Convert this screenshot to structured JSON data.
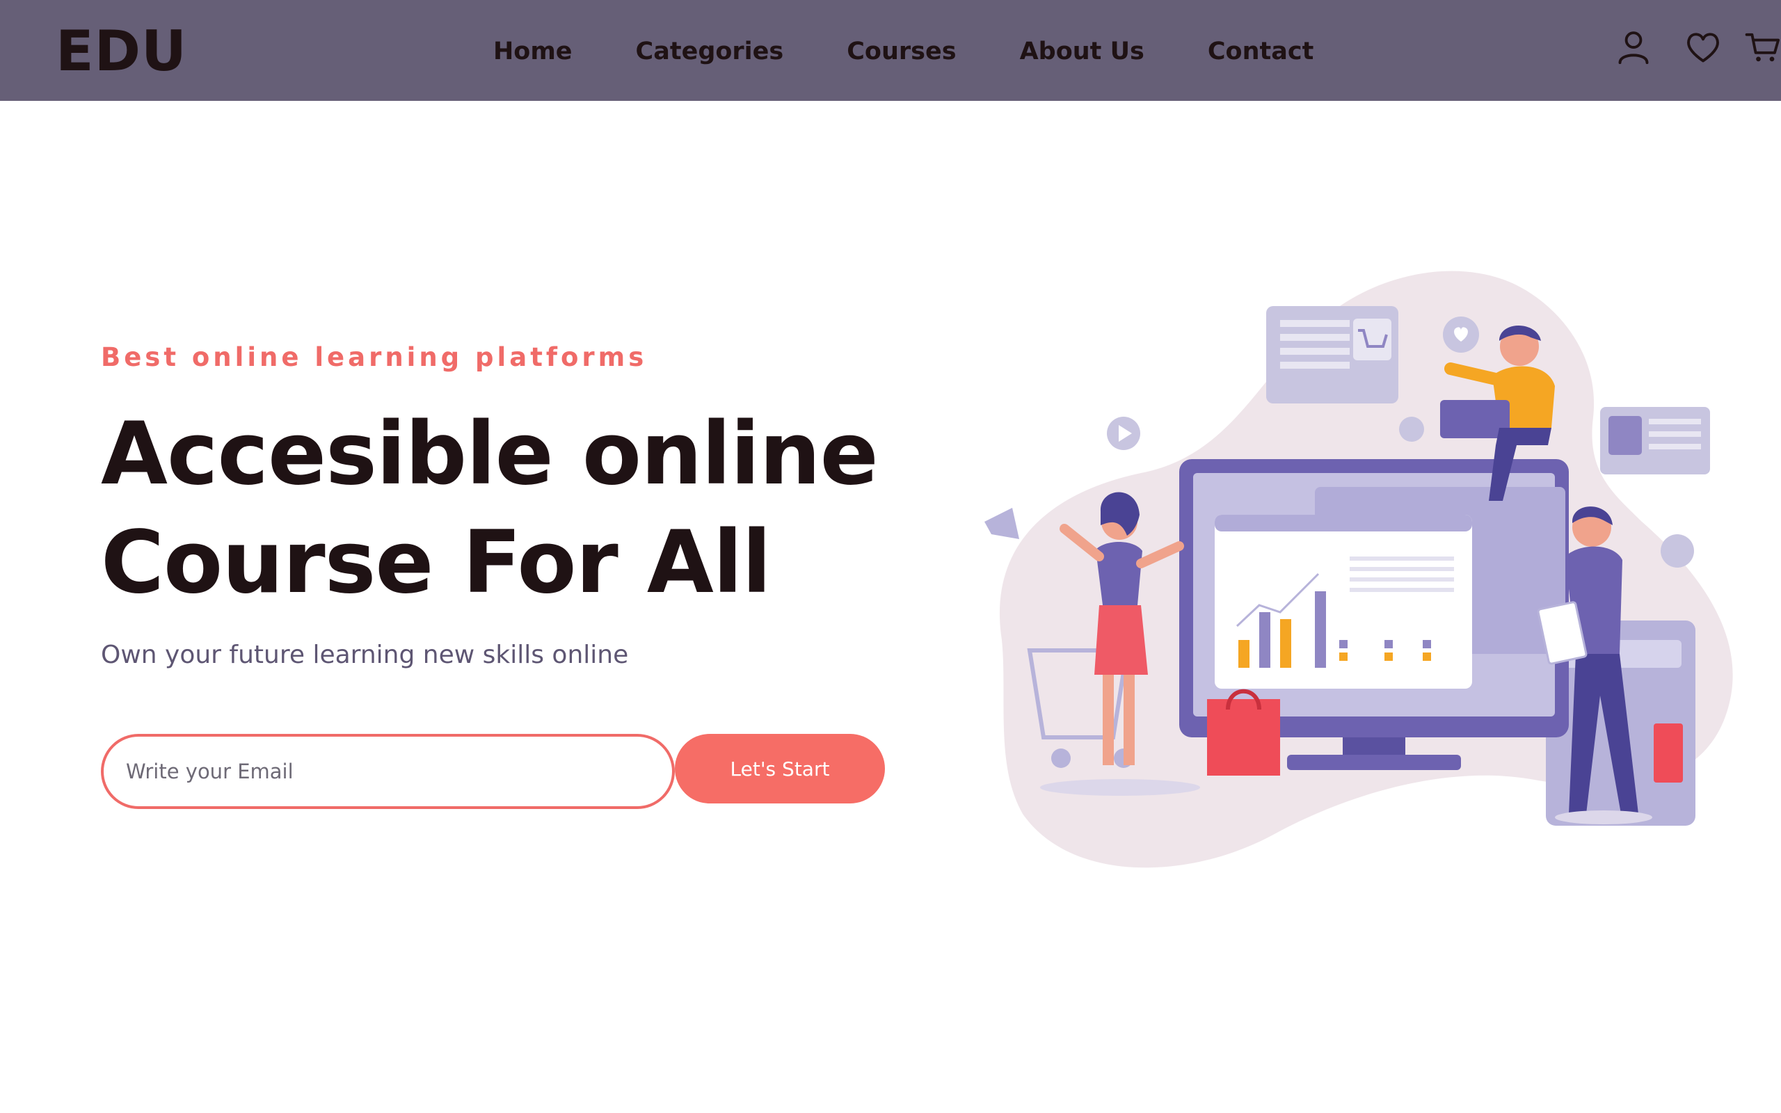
{
  "header": {
    "logo": "EDU",
    "nav": [
      {
        "label": "Home"
      },
      {
        "label": "Categories"
      },
      {
        "label": "Courses"
      },
      {
        "label": "About Us"
      },
      {
        "label": "Contact"
      }
    ],
    "icons": [
      "user-icon",
      "heart-icon",
      "cart-icon"
    ]
  },
  "hero": {
    "tagline": "Best online learning platforms",
    "headline_line1": "Accesible online",
    "headline_line2": "Course For All",
    "subline": "Own your future learning new skills online",
    "email_placeholder": "Write your Email",
    "button_label": "Let's Start"
  },
  "colors": {
    "header_bg": "#665f77",
    "text_dark": "#1f1214",
    "accent": "#f06b68",
    "button": "#f66d66",
    "subtext": "#5e5673",
    "illustration_purple": "#6d62b0",
    "illustration_blob": "#efe5ea"
  }
}
